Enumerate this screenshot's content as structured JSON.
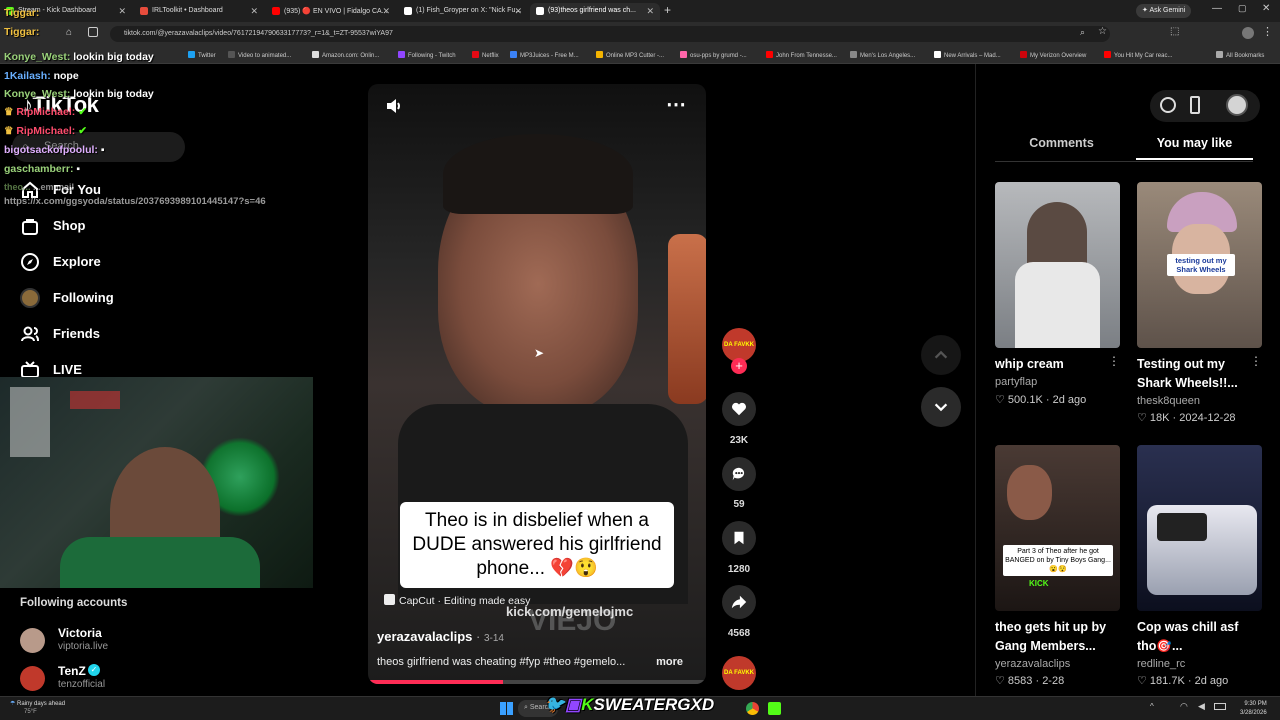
{
  "browser": {
    "tabs": [
      {
        "title": "Stream - Kick Dashboard",
        "color": "#53fc18"
      },
      {
        "title": "IRLToolkit • Dashboard",
        "color": "#e74c3c"
      },
      {
        "title": "(935) 🔴 EN VIVO | Fidalgo CA...",
        "color": "#ff0000"
      },
      {
        "title": "(1) Fish_Groyper on X: \"Nick Fu...",
        "color": "#ffffff"
      },
      {
        "title": "(93)theos girlfriend was ch...",
        "color": "#ffffff"
      }
    ],
    "ask_gemini": "Ask Gemini",
    "url": "tiktok.com/@yerazavalaclips/video/7617219479063317773?_r=1&_t=ZT-95537wiYA97",
    "bookmarks": [
      "Twitter",
      "Video to animated...",
      "Amazon.com: Onlin...",
      "Following - Twitch",
      "Netflix",
      "MP3Juices - Free M...",
      "Online MP3 Cutter -...",
      "osu-pps by grumd -...",
      "John From Tennesse...",
      "Men's Los Angeles...",
      "New Arrivals – Mad...",
      "My Verizon Overview",
      "You Hit My Car reac...",
      "All Bookmarks"
    ]
  },
  "chat": [
    {
      "user": "Tiggar:",
      "msg": "",
      "color": "#f0c040"
    },
    {
      "user": "Tiggar:",
      "msg": "",
      "color": "#f0c040"
    },
    {
      "user": "Konye_West:",
      "msg": "lookin big today",
      "color": "#9ad27a"
    },
    {
      "user": "1Kailash:",
      "msg": "nope",
      "color": "#6ab0ff"
    },
    {
      "user": "Konye_West:",
      "msg": "lookin big today",
      "color": "#9ad27a"
    },
    {
      "user": "RipMichael:",
      "msg": "",
      "color": "#ff4d6d"
    },
    {
      "user": "RipMichael:",
      "msg": "",
      "color": "#ff4d6d"
    },
    {
      "user": "bigotsackofpoolul:",
      "msg": "",
      "color": "#e0b0ff"
    },
    {
      "user": "gaschamberr:",
      "msg": "",
      "color": "#9ad27a"
    },
    {
      "user": "theo...",
      "msg": "...em mail",
      "color": "#9ad27a"
    },
    {
      "user": "",
      "msg": "https://x.com/ggsyoda/status/2037693989101445147?s=46",
      "color": "#ffffff"
    }
  ],
  "sidebar": {
    "logo": "TikTok",
    "search_placeholder": "Search",
    "items": [
      {
        "label": "For You",
        "icon": "home-icon"
      },
      {
        "label": "Shop",
        "icon": "shop-icon"
      },
      {
        "label": "Explore",
        "icon": "compass-icon"
      },
      {
        "label": "Following",
        "icon": "avatar-icon"
      },
      {
        "label": "Friends",
        "icon": "friends-icon"
      },
      {
        "label": "LIVE",
        "icon": "live-icon"
      }
    ],
    "following_title": "Following accounts",
    "accounts": [
      {
        "name": "Victoria",
        "handle": "viptoria.live",
        "verified": false
      },
      {
        "name": "TenZ",
        "handle": "tenzofficial",
        "verified": true
      }
    ]
  },
  "video": {
    "caption": "Theo is in disbelief when a DUDE answered his girlfriend phone... 💔😲",
    "capcut": "CapCut · Editing made easy",
    "watermark": "kick.com/gemelojmc",
    "bg_text": "VIEJO",
    "author": "yerazavalaclips",
    "duration": "3-14",
    "description": "theos girlfriend was cheating #fyp #theo #gemelo...",
    "more": "more",
    "progress": 0.4,
    "likes": "23K",
    "comments": "59",
    "saves": "1280",
    "shares": "4568",
    "creator_badge": "DA FAVKK"
  },
  "right_panel": {
    "tabs": [
      "Comments",
      "You may like"
    ],
    "active_tab": "You may like",
    "cards": [
      {
        "title": "whip cream",
        "title2": "",
        "author": "partyflap",
        "likes": "500.1K",
        "date": "2d ago",
        "thumb": "#9aa0a6",
        "overlay": ""
      },
      {
        "title": "Testing out my",
        "title2": "Shark Wheels!!...",
        "author": "thesk8queen",
        "likes": "18K",
        "date": "2024-12-28",
        "thumb": "#8c7b6e",
        "overlay": "testing out my Shark Wheels"
      },
      {
        "title": "theo gets hit up by",
        "title2": "Gang Members...",
        "author": "yerazavalaclips",
        "likes": "8583",
        "date": "2-28",
        "thumb": "#3a2e2a",
        "overlay": "Part 3 of Theo after he got BANGED on by Tiny Boys Gang... 😮😯"
      },
      {
        "title": "Cop was chill asf",
        "title2": "tho🎯...",
        "author": "redline_rc",
        "likes": "181.7K",
        "date": "2d ago",
        "thumb": "#2a2f45",
        "overlay": ""
      }
    ]
  },
  "taskbar": {
    "weather": "Rainy days ahead",
    "temp": "75°F",
    "search": "Search",
    "banner": "SWEATERGXD",
    "time": "9:30 PM",
    "date": "3/28/2026"
  }
}
